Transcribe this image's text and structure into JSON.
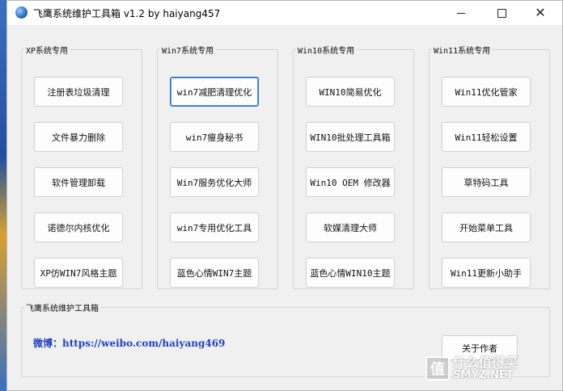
{
  "window": {
    "title": "飞鹰系统维护工具箱 v1.2 by haiyang457"
  },
  "groups": {
    "xp": {
      "title": "XP系统专用",
      "buttons": [
        "注册表垃圾清理",
        "文件暴力删除",
        "软件管理卸载",
        "诺德尔内核优化",
        "XP仿WIN7风格主题"
      ]
    },
    "win7": {
      "title": "Win7系统专用",
      "buttons": [
        "win7减肥清理优化",
        "win7瘦身秘书",
        "Win7服务优化大师",
        "win7专用优化工具",
        "蓝色心情WIN7主题"
      ]
    },
    "win10": {
      "title": "Win10系统专用",
      "buttons": [
        "WIN10简易优化",
        "WIN10批处理工具箱",
        "Win10 OEM 修改器",
        "软媒清理大师",
        "蓝色心情WIN10主题"
      ]
    },
    "win11": {
      "title": "Win11系统专用",
      "buttons": [
        "Win11优化管家",
        "Win11轻松设置",
        "草特码工具",
        "开始菜单工具",
        "Win11更新小助手"
      ]
    }
  },
  "footer": {
    "title": "飞鹰系统维护工具箱",
    "weibo": "微博：https://weibo.com/haiyang469",
    "about_button": "关于作者"
  },
  "watermark": {
    "mark": "值",
    "text": "什么值得买",
    "site": "SMYZ.NET"
  }
}
